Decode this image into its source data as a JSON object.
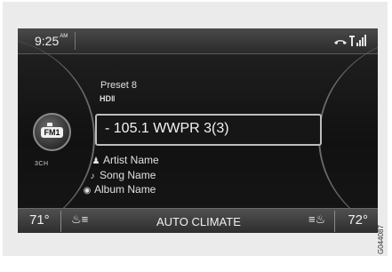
{
  "status_bar": {
    "time": "9:25",
    "time_suffix": "AM"
  },
  "radio": {
    "band": "FM1",
    "channel_mode": "3CH",
    "preset": "Preset 8",
    "hd_label": "HD",
    "station": "- 105.1 WWPR 3(3)",
    "artist": "Artist Name",
    "song": "Song Name",
    "album": "Album Name"
  },
  "climate": {
    "left_temp": "71°",
    "label": "AUTO CLIMATE",
    "right_temp": "72°"
  },
  "figure_code": "G044087",
  "icons": {
    "phone": "phone-icon",
    "signal": "signal-strength-icon",
    "seat_left": "seat-heater-icon",
    "seat_right": "seat-heater-icon"
  }
}
